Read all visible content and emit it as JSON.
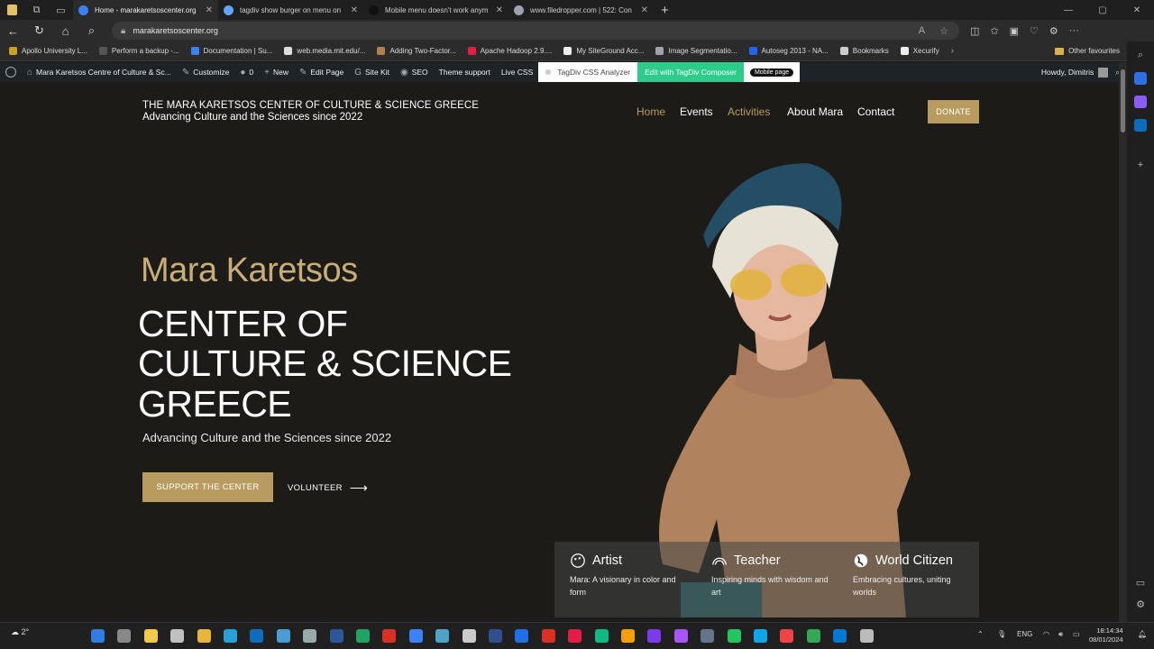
{
  "browser": {
    "tabs": [
      {
        "title": "Home - marakaretsoscenter.org",
        "active": true,
        "color": "#3b82f6"
      },
      {
        "title": "tagdiv show burger on menu on",
        "active": false,
        "color": "#60a5fa"
      },
      {
        "title": "Mobile menu doesn't work anym",
        "active": false,
        "color": "#111111"
      },
      {
        "title": "www.filedropper.com | 522: Con",
        "active": false,
        "color": "#9ca3af"
      }
    ],
    "url": "marakaretsoscenter.org",
    "bookmarks": [
      {
        "label": "Apollo University L...",
        "color": "#c9a227"
      },
      {
        "label": "Perform a backup -...",
        "color": "#555555"
      },
      {
        "label": "Documentation | Su...",
        "color": "#3b82f6"
      },
      {
        "label": "web.media.mit.edu/...",
        "color": "#dddddd"
      },
      {
        "label": "Adding Two-Factor...",
        "color": "#b08050"
      },
      {
        "label": "Apache Hadoop 2.9....",
        "color": "#e11d48"
      },
      {
        "label": "My SiteGround Acc...",
        "color": "#eeeeee"
      },
      {
        "label": "Image Segmentatio...",
        "color": "#9ca3af"
      },
      {
        "label": "Autoseg 2013 - NA...",
        "color": "#2563eb"
      },
      {
        "label": "Bookmarks",
        "color": "#cccccc"
      },
      {
        "label": "Xecurify",
        "color": "#eeeeee"
      }
    ],
    "other_bookmarks": "Other favourites"
  },
  "wp_admin": {
    "site": "Mara Karetsos Centre of Culture & Sc...",
    "customize": "Customize",
    "comments": "0",
    "new": "New",
    "edit_page": "Edit Page",
    "site_kit": "Site Kit",
    "seo": "SEO",
    "theme_support": "Theme support",
    "live_css": "Live CSS",
    "tagdiv_analyzer": "TagDiv CSS Analyzer",
    "edit_tagdiv": "Edit with TagDiv Composer",
    "mobile_page": "Mobile page",
    "howdy": "Howdy, Dimitris"
  },
  "site": {
    "brand_title": "THE MARA KARETSOS CENTER OF CULTURE & SCIENCE GREECE",
    "brand_tagline": "Advancing Culture and the Sciences since 2022",
    "nav": [
      {
        "label": "Home",
        "color": "#b89b5e"
      },
      {
        "label": "Events",
        "color": "#ffffff"
      },
      {
        "label": "Activities",
        "color": "#b89b5e"
      },
      {
        "label": "About Mara",
        "color": "#ffffff"
      },
      {
        "label": "Contact",
        "color": "#ffffff"
      }
    ],
    "donate": "DONATE",
    "hero": {
      "name": "Mara Karetsos",
      "line1": "CENTER OF",
      "line2": "CULTURE & SCIENCE",
      "line3": "GREECE",
      "subtitle": "Advancing Culture and the Sciences since 2022",
      "support_btn": "SUPPORT THE CENTER",
      "volunteer_btn": "VOLUNTEER"
    },
    "cards": [
      {
        "title": "Artist",
        "desc": "Mara: A visionary in color and form"
      },
      {
        "title": "Teacher",
        "desc": "Inspiring minds with wisdom and art"
      },
      {
        "title": "World Citizen",
        "desc": "Embracing cultures, uniting worlds"
      }
    ]
  },
  "taskbar": {
    "weather": "2°",
    "lang": "ENG",
    "time": "18:14:34",
    "date": "08/01/2024"
  }
}
